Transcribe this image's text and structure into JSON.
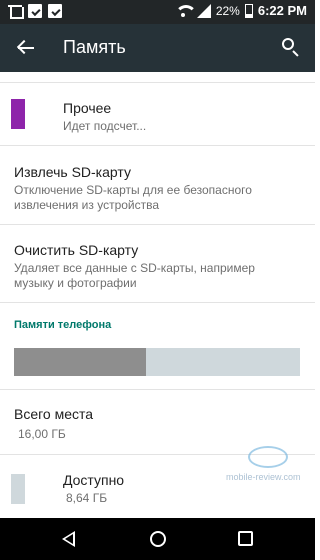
{
  "status_bar": {
    "battery": "22%",
    "time": "6:22 PM",
    "left_icons": [
      "trash-icon",
      "clipboard-check-icon",
      "clipboard-check-icon"
    ]
  },
  "app_bar": {
    "title": "Память",
    "back_icon": "arrow-back-icon",
    "search_icon": "search-icon"
  },
  "other_item": {
    "label": "Прочее",
    "detail": "Идет подсчет...",
    "color": "#8e24aa"
  },
  "unmount_item": {
    "title": "Извлечь SD-карту",
    "description_line1": "Отключение SD-карты для ее безопасного",
    "description_line2": "извлечения из устройства"
  },
  "erase_item": {
    "title": "Очистить SD-карту",
    "description_line1": "Удаляет все данные с SD-карты, например",
    "description_line2": "музыку и фотографии"
  },
  "phone_memory": {
    "section_title": "Памяти телефона",
    "used_fraction": 0.46,
    "used_color": "#8e8e8e",
    "free_color": "#cfd8dc"
  },
  "total_space": {
    "label": "Всего места",
    "value": "16,00 ГБ"
  },
  "available": {
    "label": "Доступно",
    "value": "8,64 ГБ",
    "color": "#cfd8dc"
  },
  "watermark": {
    "text": "mobile-review.com"
  },
  "nav_bar": {
    "icons": [
      "nav-back-icon",
      "nav-home-icon",
      "nav-recent-apps-icon"
    ]
  }
}
